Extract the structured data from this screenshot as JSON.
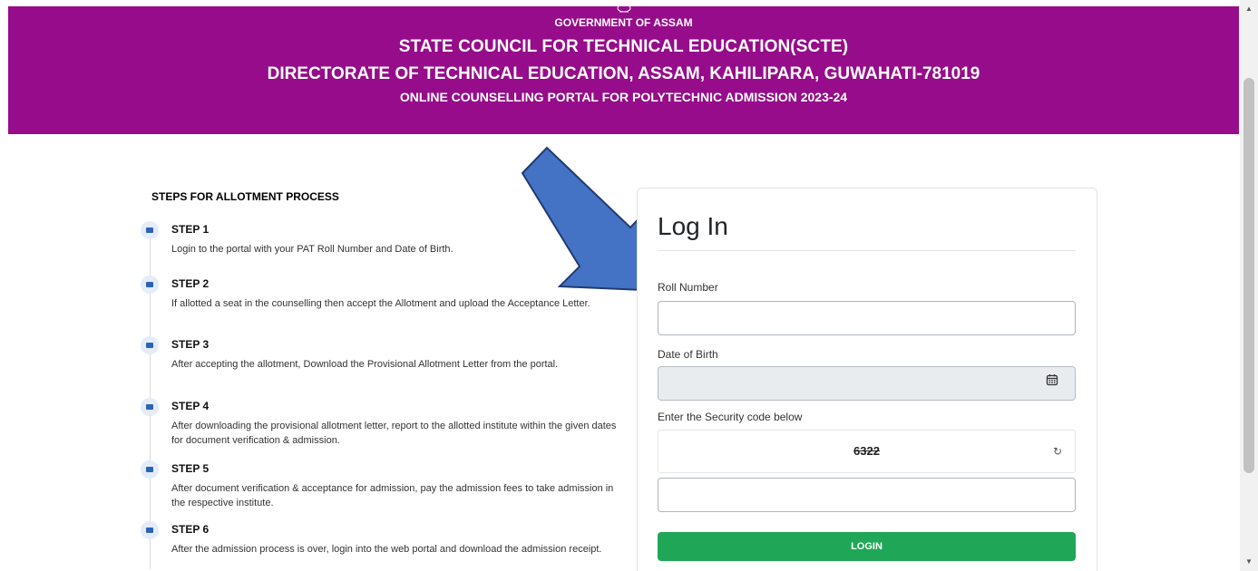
{
  "header": {
    "government": "GOVERNMENT OF ASSAM",
    "council": "STATE COUNCIL FOR TECHNICAL EDUCATION(SCTE)",
    "directorate": "DIRECTORATE OF TECHNICAL EDUCATION, ASSAM, KAHILIPARA, GUWAHATI-781019",
    "portal": "ONLINE COUNSELLING PORTAL FOR POLYTECHNIC ADMISSION 2023-24",
    "bg_color": "#960c8a"
  },
  "steps": {
    "title": "STEPS FOR ALLOTMENT PROCESS",
    "items": [
      {
        "title": "STEP 1",
        "text": "Login to the portal with your PAT Roll Number and Date of Birth."
      },
      {
        "title": "STEP 2",
        "text": "If allotted a seat in the counselling then accept the Allotment and upload the Acceptance Letter."
      },
      {
        "title": "STEP 3",
        "text": "After accepting the allotment, Download the Provisional Allotment Letter from the portal."
      },
      {
        "title": "STEP 4",
        "text": "After downloading the provisional allotment letter, report to the allotted institute within the given dates for document verification & admission."
      },
      {
        "title": "STEP 5",
        "text": "After document verification & acceptance for admission, pay the admission fees to take admission in the respective institute."
      },
      {
        "title": "STEP 6",
        "text": "After the admission process is over, login into the web portal and download the admission receipt."
      }
    ]
  },
  "login": {
    "title": "Log In",
    "roll_label": "Roll Number",
    "roll_value": "",
    "dob_label": "Date of Birth",
    "dob_value": "",
    "security_label": "Enter the Security code below",
    "captcha_code": "6322",
    "captcha_value": "",
    "button_label": "LOGIN",
    "button_color": "#1fa757"
  },
  "icons": {
    "step": "calendar-icon",
    "calendar": "calendar-icon",
    "refresh": "refresh-icon",
    "arrow": "arrow-annotation"
  },
  "colors": {
    "arrow_fill": "#4472c4",
    "arrow_stroke": "#1f3b70"
  }
}
